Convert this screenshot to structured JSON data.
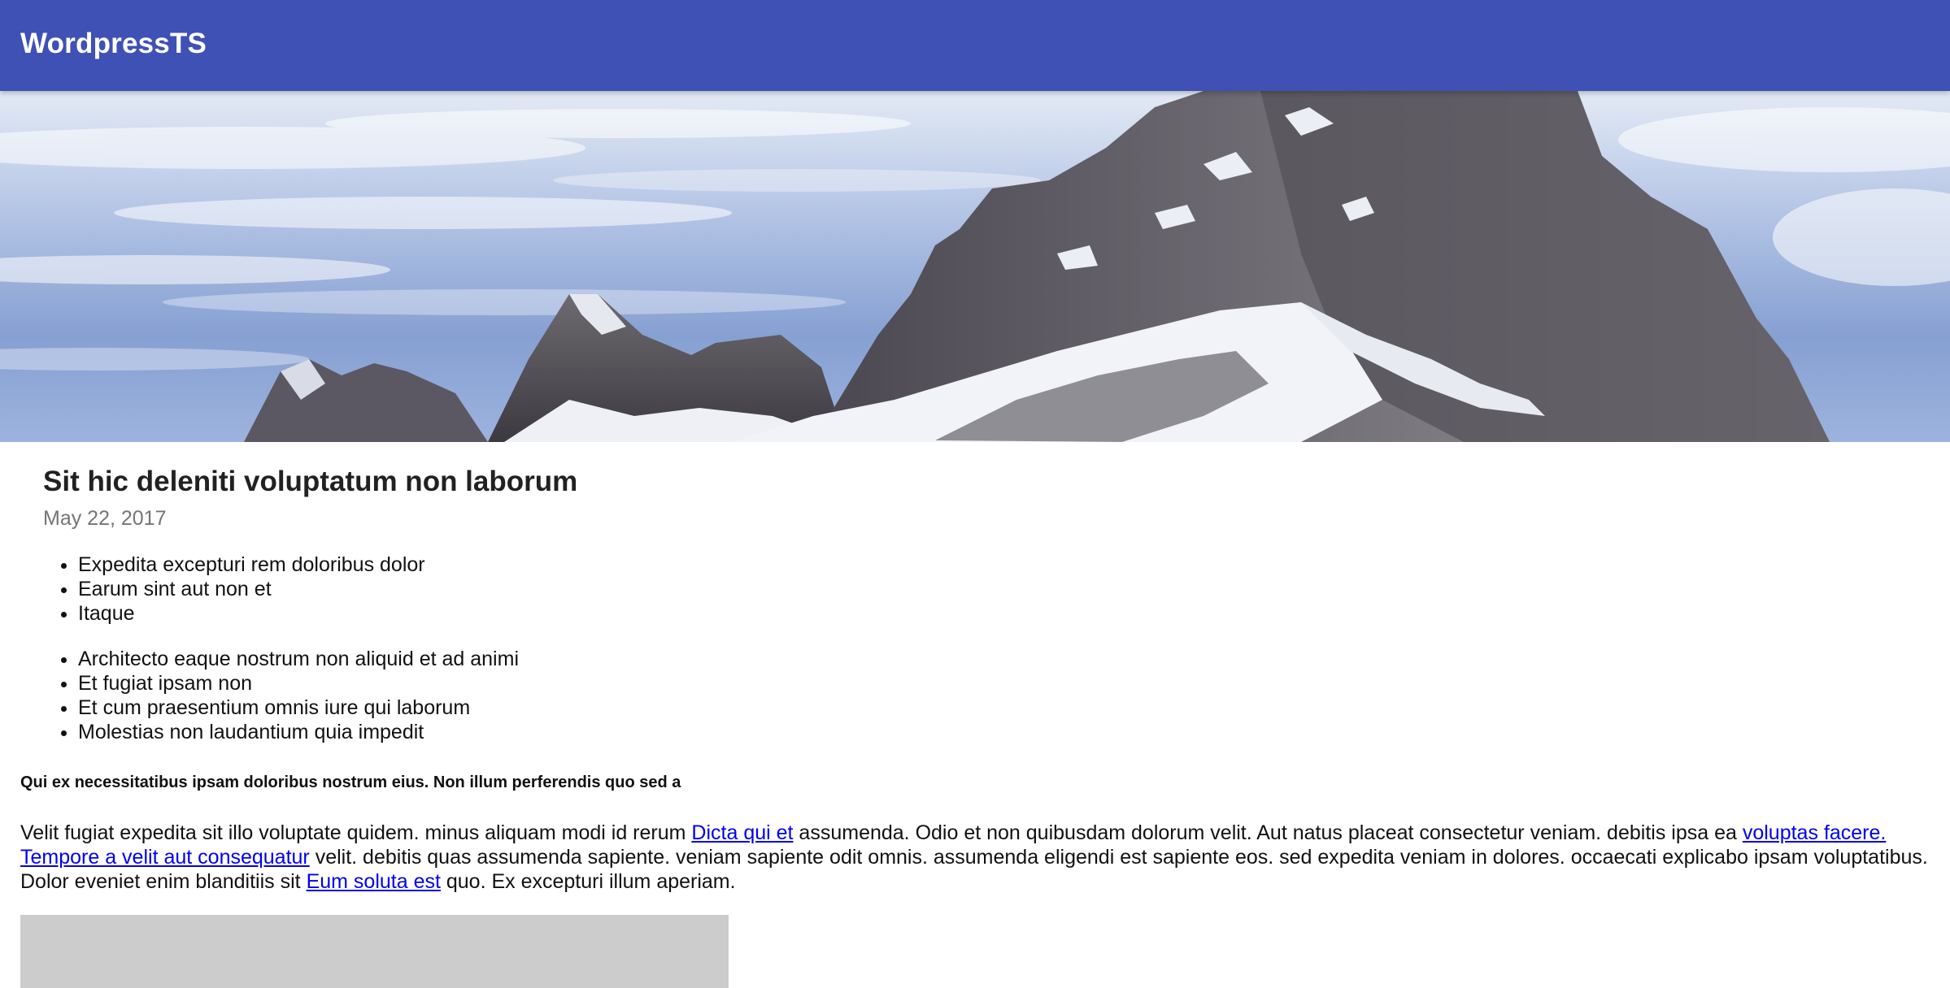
{
  "app": {
    "title": "WordpressTS"
  },
  "colors": {
    "appbar": "#3f51b5",
    "link": "#0000ee",
    "placeholder": "#cccccc"
  },
  "post": {
    "title": "Sit hic deleniti voluptatum non laborum",
    "date": "May 22, 2017",
    "list1": [
      "Expedita excepturi rem doloribus dolor",
      "Earum sint aut non et",
      "Itaque"
    ],
    "list2": [
      "Architecto eaque nostrum non aliquid et ad animi",
      "Et fugiat ipsam non",
      "Et cum praesentium omnis iure qui laborum",
      "Molestias non laudantium quia impedit"
    ],
    "subheading": "Qui ex necessitatibus ipsam doloribus nostrum eius. Non illum perferendis quo sed a",
    "paragraph": {
      "t1": "Velit fugiat expedita sit illo voluptate quidem. minus aliquam modi id rerum ",
      "link1": "Dicta qui et",
      "t2": " assumenda. Odio et non quibusdam dolorum velit. Aut natus placeat consectetur veniam. debitis ipsa ea ",
      "link2": "voluptas facere.",
      "t3": " ",
      "link3": "Tempore a velit aut consequatur",
      "t4": " velit. debitis quas assumenda sapiente. veniam sapiente odit omnis. assumenda eligendi est sapiente eos. sed expedita veniam in dolores. occaecati explicabo ipsam voluptatibus. Dolor eveniet enim blanditiis sit ",
      "link4": "Eum soluta est",
      "t5": " quo. Ex excepturi illum aperiam."
    }
  }
}
